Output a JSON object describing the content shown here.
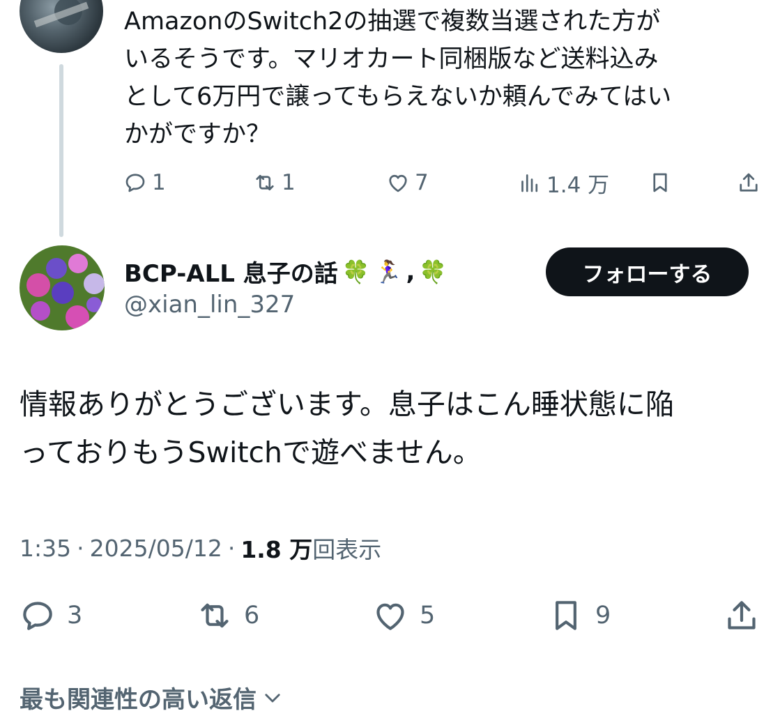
{
  "parent_tweet": {
    "text_lines": [
      "AmazonのSwitch2の抽選で複数当選された方が",
      "いるそうです。マリオカート同梱版など送料込み",
      "として6万円で譲ってもらえないか頼んでみてはい",
      "かがですか？"
    ],
    "actions": {
      "replies": "1",
      "reposts": "1",
      "likes": "7",
      "views": "1.4 万"
    }
  },
  "reply_tweet": {
    "display_name": "BCP-ALL 息子の話",
    "name_emojis": [
      "🍀",
      "🏃‍♀️",
      ",",
      "🍀"
    ],
    "handle": "@xian_lin_327",
    "follow_label": "フォローする",
    "text_lines": [
      "情報ありがとうございます。息子はこん睡状態に陥",
      "っておりもうSwitchで遊べません。"
    ],
    "time": "1:35",
    "date": "2025/05/12",
    "separator": "·",
    "views_count": "1.8 万",
    "views_label": "回表示",
    "actions": {
      "replies": "3",
      "reposts": "6",
      "likes": "5",
      "bookmarks": "9"
    }
  },
  "sort_label": "最も関連性の高い返信",
  "colors": {
    "text": "#0f1419",
    "muted": "#536471",
    "thread_line": "#cfd9de",
    "button_bg": "#0f1419"
  }
}
